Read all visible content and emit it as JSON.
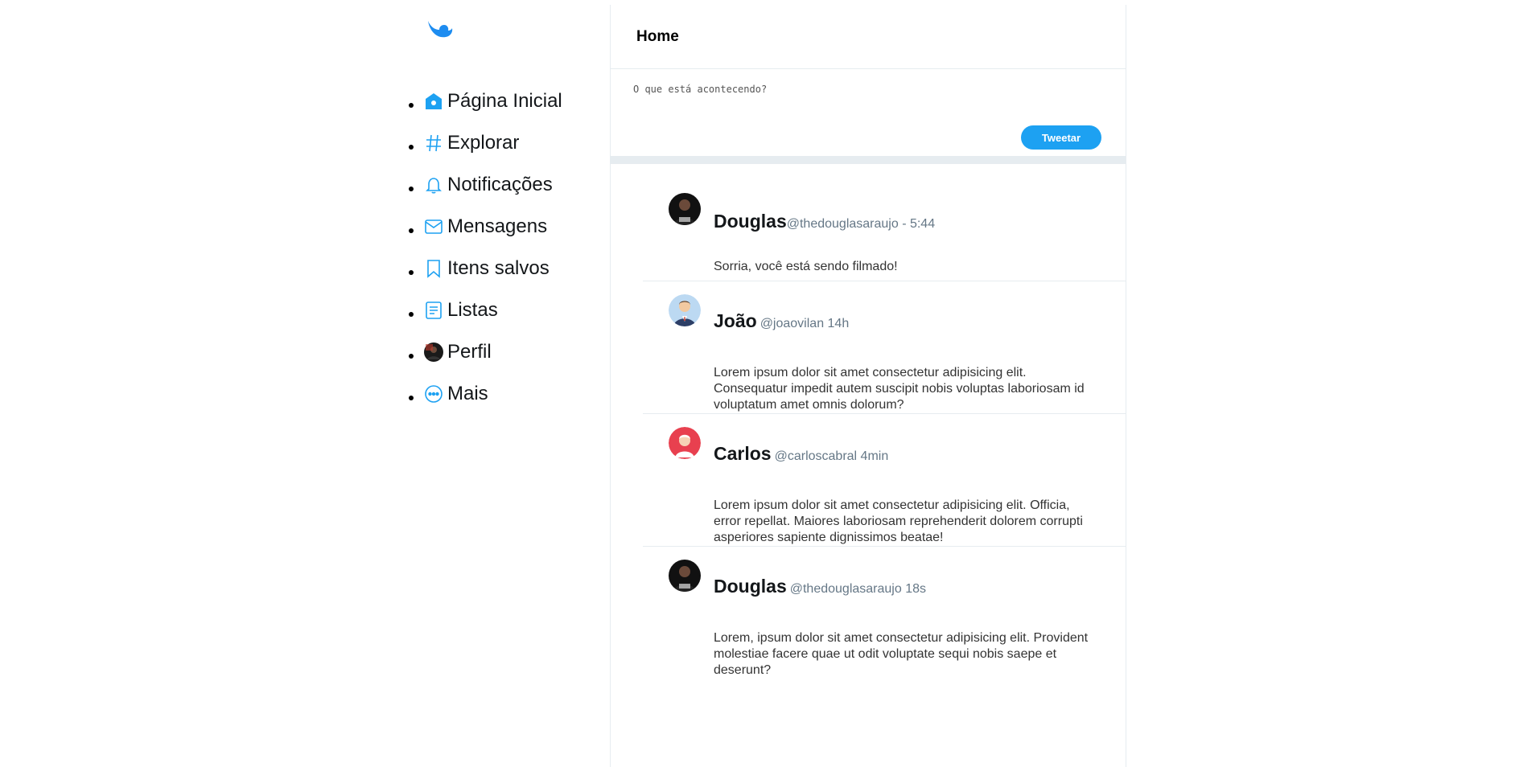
{
  "app": {
    "logo_icon": "bird-logo-icon",
    "accent_color": "#1da1f2"
  },
  "sidebar": {
    "items": [
      {
        "label": "Página Inicial",
        "icon": "home-icon"
      },
      {
        "label": "Explorar",
        "icon": "hashtag-icon"
      },
      {
        "label": "Notificações",
        "icon": "bell-icon"
      },
      {
        "label": "Mensagens",
        "icon": "envelope-icon"
      },
      {
        "label": "Itens salvos",
        "icon": "bookmark-icon"
      },
      {
        "label": "Listas",
        "icon": "list-icon"
      },
      {
        "label": "Perfil",
        "icon": "profile-avatar-icon"
      },
      {
        "label": "Mais",
        "icon": "more-icon"
      }
    ]
  },
  "header": {
    "title": "Home"
  },
  "composer": {
    "placeholder": "O que está acontecendo?",
    "value": "",
    "button_label": "Tweetar"
  },
  "feed": {
    "tweets": [
      {
        "name": "Douglas",
        "meta": "@thedouglasaraujo - 5:44",
        "text": "Sorria, você está sendo filmado!",
        "avatar": "photo-avatar"
      },
      {
        "name": "João",
        "meta": "@joaovilan 14h",
        "text": "Lorem ipsum dolor sit amet consectetur adipisicing elit. Consequatur impedit autem suscipit nobis voluptas laboriosam id voluptatum amet omnis dolorum?",
        "avatar": "businessman-avatar"
      },
      {
        "name": "Carlos",
        "meta": "@carloscabral 4min",
        "text": "Lorem ipsum dolor sit amet consectetur adipisicing elit. Officia, error repellat. Maiores laboriosam reprehenderit dolorem corrupti asperiores sapiente dignissimos beatae!",
        "avatar": "person-red-avatar"
      },
      {
        "name": "Douglas",
        "meta": "@thedouglasaraujo 18s",
        "text": "Lorem, ipsum dolor sit amet consectetur adipisicing elit. Provident molestiae facere quae ut odit voluptate sequi nobis saepe et deserunt?",
        "avatar": "photo-avatar"
      }
    ]
  }
}
